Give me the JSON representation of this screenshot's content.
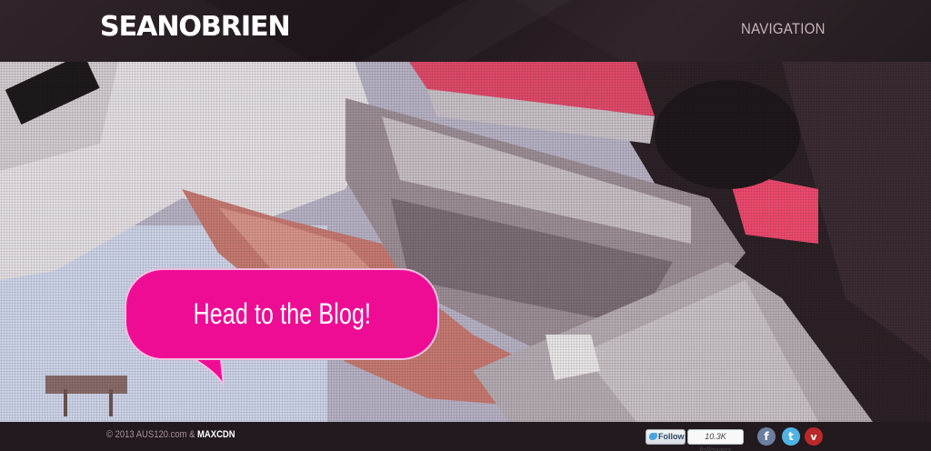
{
  "header": {
    "logo_text": "SEANOBRIEN",
    "nav_label": "NAVIGATION"
  },
  "hero": {
    "cta_label": "Head to the Blog!",
    "accent_color": "#ee0c95"
  },
  "footer": {
    "copyright_prefix": "© 2013 AUS120.com & ",
    "copyright_brand": "MAXCDN",
    "follow_label": "Follow",
    "follower_count": "10.3K followers",
    "social_icons": {
      "facebook": "f",
      "twitter": "t",
      "vimeo": "v"
    }
  }
}
